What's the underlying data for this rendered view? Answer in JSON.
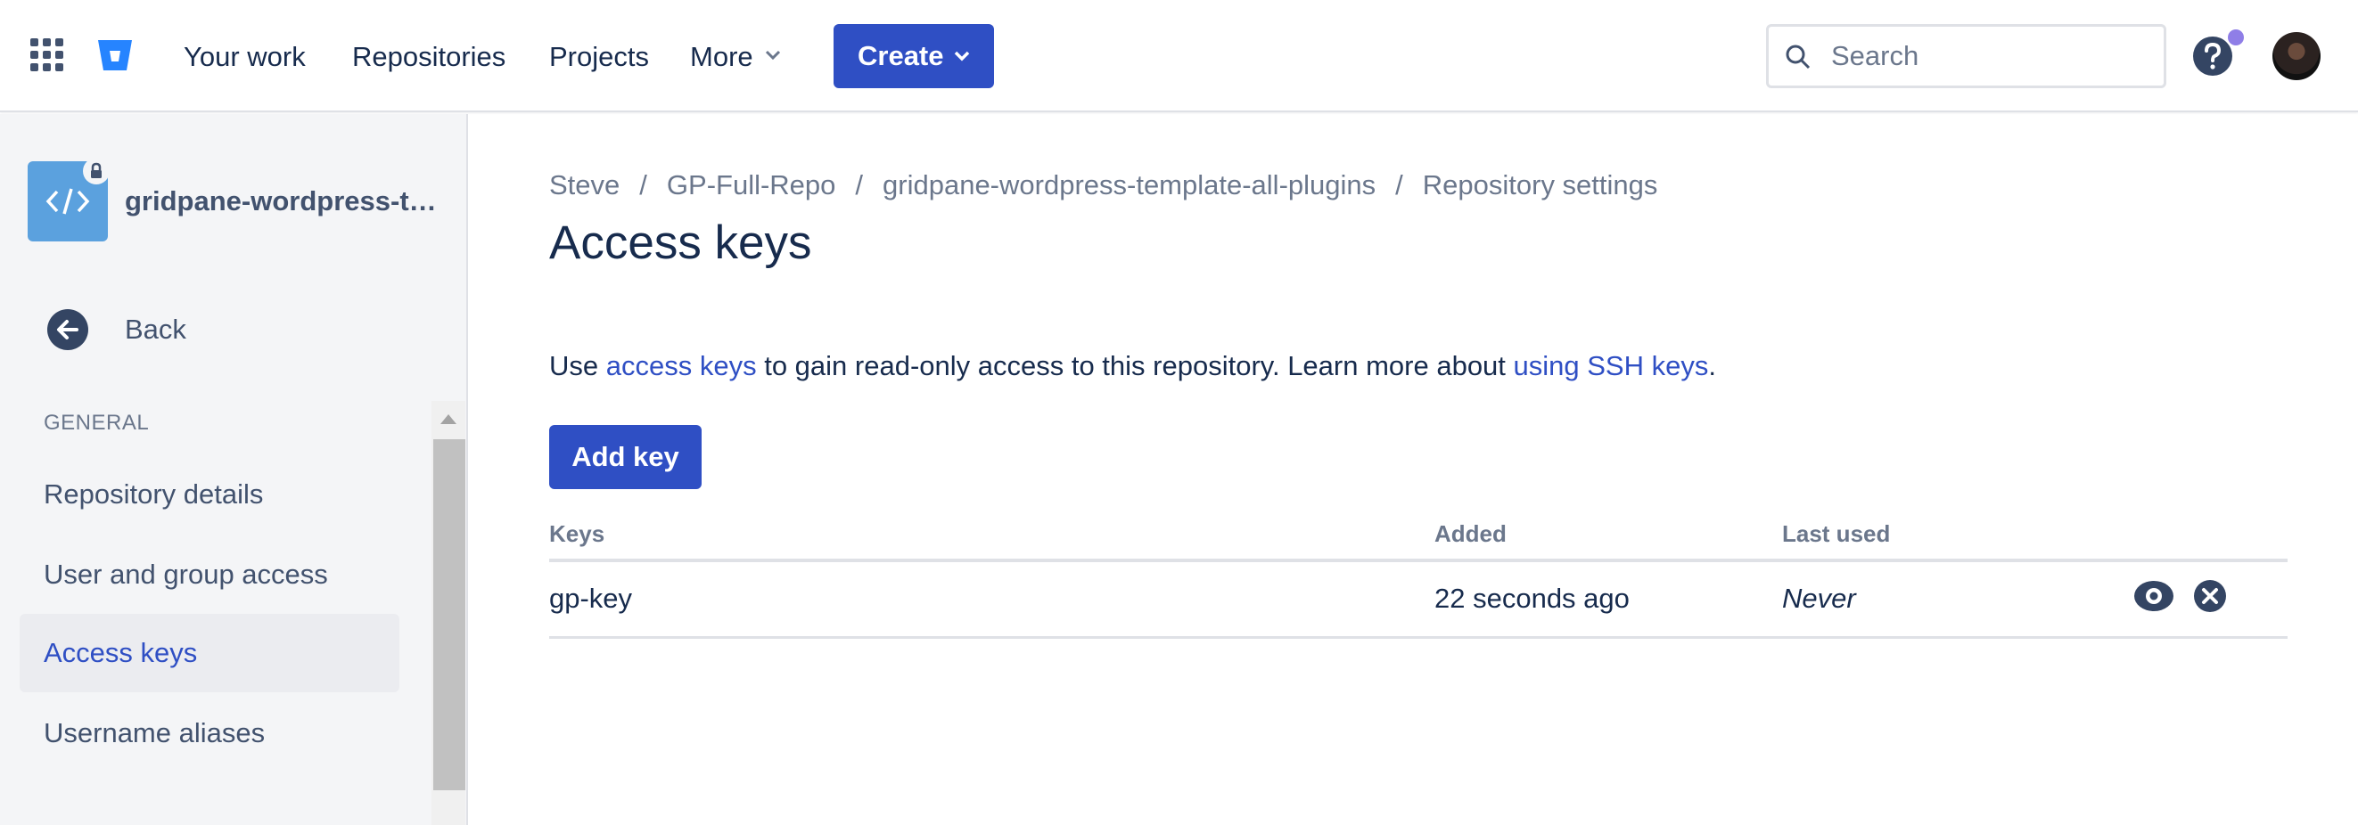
{
  "topnav": {
    "links": {
      "your_work": "Your work",
      "repositories": "Repositories",
      "projects": "Projects",
      "more": "More"
    },
    "create_label": "Create",
    "search_placeholder": "Search"
  },
  "sidebar": {
    "repo_name": "gridpane-wordpress-template-all-plugins",
    "back_label": "Back",
    "section_heading": "GENERAL",
    "items": [
      {
        "label": "Repository details",
        "active": false
      },
      {
        "label": "User and group access",
        "active": false
      },
      {
        "label": "Access keys",
        "active": true
      },
      {
        "label": "Username aliases",
        "active": false
      }
    ]
  },
  "main": {
    "breadcrumbs": [
      "Steve",
      "GP-Full-Repo",
      "gridpane-wordpress-template-all-plugins",
      "Repository settings"
    ],
    "breadcrumb_separator": "/",
    "title": "Access keys",
    "intro": {
      "part1": "Use ",
      "link1": "access keys",
      "part2": " to gain read-only access to this repository. Learn more about ",
      "link2": "using SSH keys",
      "part3": "."
    },
    "add_key_label": "Add key",
    "table": {
      "headers": {
        "keys": "Keys",
        "added": "Added",
        "last_used": "Last used"
      },
      "rows": [
        {
          "key": "gp-key",
          "added": "22 seconds ago",
          "last_used": "Never"
        }
      ]
    }
  },
  "colors": {
    "primary": "#2f4fc4",
    "text": "#172b4d",
    "subtle_text": "#6b778c",
    "sidebar_bg": "#f4f5f7",
    "notification_dot": "#8f7ee7"
  },
  "icons": [
    "app-switcher-icon",
    "bitbucket-logo-icon",
    "chevron-down-icon",
    "search-icon",
    "help-icon",
    "avatar",
    "code-icon",
    "lock-icon",
    "arrow-left-icon",
    "eye-icon",
    "close-circle-icon"
  ]
}
